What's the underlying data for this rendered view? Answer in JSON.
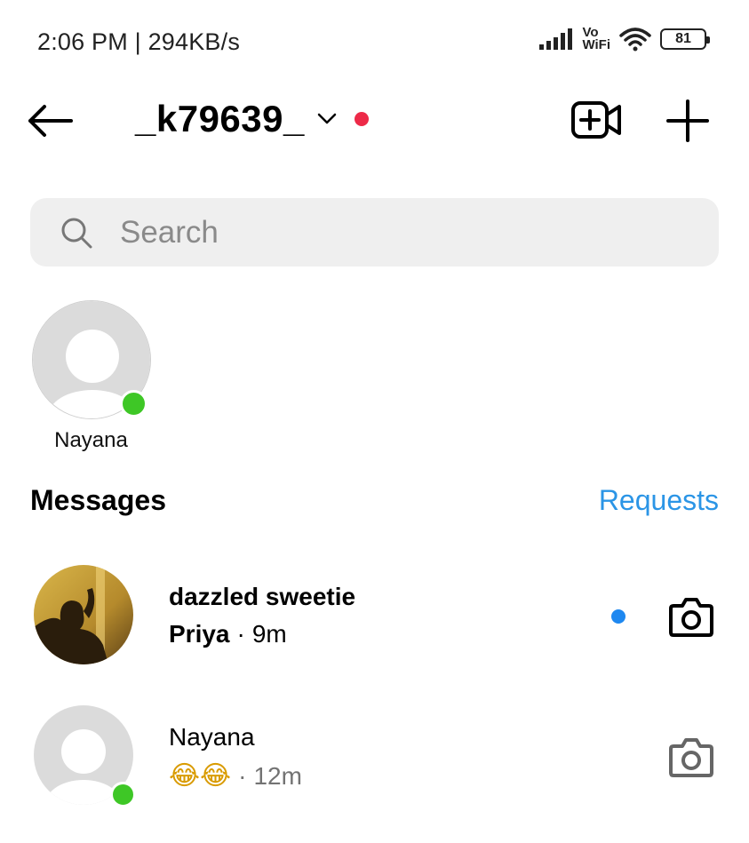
{
  "status_bar": {
    "time_speed": "2:06 PM | 294KB/s",
    "vowifi_top": "Vo",
    "vowifi_bottom": "WiFi",
    "battery": "81"
  },
  "header": {
    "account_name": "_k79639_",
    "has_notification_dot": true
  },
  "search": {
    "placeholder": "Search"
  },
  "active_now": [
    {
      "name": "Nayana",
      "online": true
    }
  ],
  "messages": {
    "title": "Messages",
    "requests_label": "Requests",
    "threads": [
      {
        "name": "dazzled sweetie",
        "sender": "Priya",
        "separator": "·",
        "time": "9m",
        "unread": true
      },
      {
        "name": "Nayana",
        "preview": "😂😂",
        "separator": "·",
        "time": "12m",
        "unread": false,
        "online": true
      }
    ]
  },
  "colors": {
    "accent_blue": "#2b95e6",
    "unread_dot": "#1e88f0",
    "online_green": "#3ec726",
    "notification_red": "#ed2a48",
    "search_bg": "#efefef"
  }
}
